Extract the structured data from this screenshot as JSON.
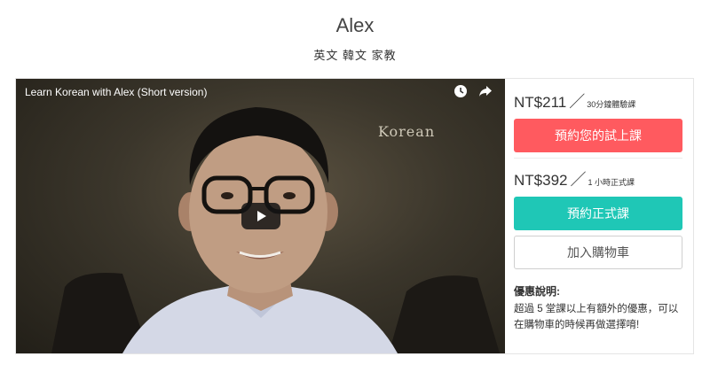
{
  "tutor": {
    "name": "Alex",
    "subjects": "英文 韓文 家教"
  },
  "video": {
    "title": "Learn Korean with Alex (Short version)",
    "watermark": "Korean",
    "icons": [
      "clock-icon",
      "share-arrow-icon",
      "play-icon"
    ]
  },
  "pricing": {
    "trial": {
      "price": "NT$211",
      "unit": "30分鐘體驗課",
      "button_label": "預約您的試上課"
    },
    "regular": {
      "price": "NT$392",
      "unit": "1 小時正式課",
      "button_label": "預約正式課"
    },
    "cart_button_label": "加入購物車"
  },
  "promo": {
    "title": "優惠說明:",
    "text": "超過 5 堂課以上有額外的優惠，可以在購物車的時候再做選擇唷!"
  },
  "colors": {
    "trial_button": "#ff5a5f",
    "regular_button": "#1fc7b6"
  }
}
